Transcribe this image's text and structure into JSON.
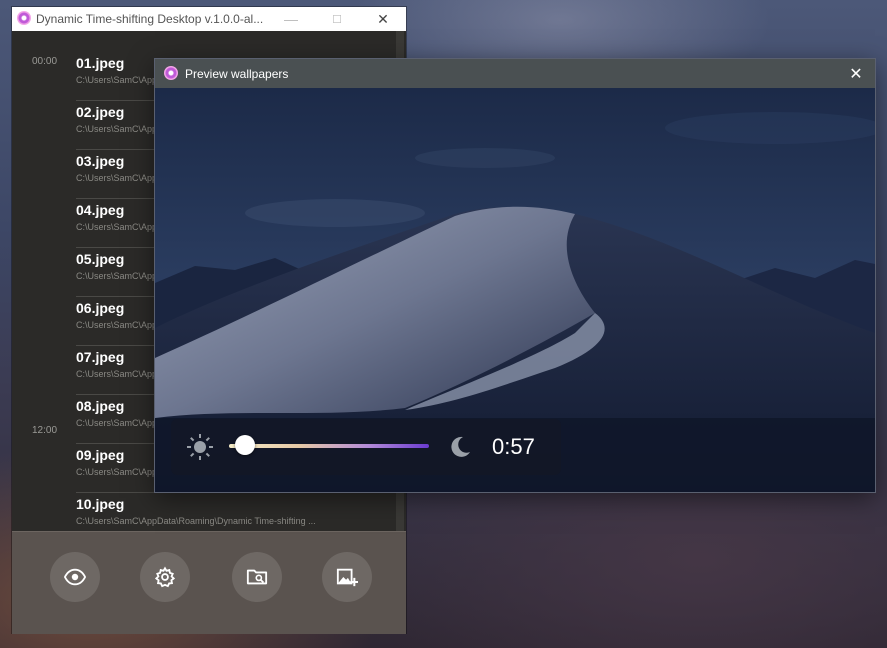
{
  "main_window": {
    "title": "Dynamic Time-shifting Desktop v.1.0.0-al...",
    "controls": {
      "minimize": "—",
      "maximize": "☐",
      "close": "✕"
    }
  },
  "file_list": {
    "time_labels": [
      "00:00",
      "12:00"
    ],
    "items": [
      {
        "name": "01.jpeg",
        "path": "C:\\Users\\SamC\\AppData\\Roaming\\Dynamic Time-shifting ..."
      },
      {
        "name": "02.jpeg",
        "path": "C:\\Users\\SamC\\AppData\\Roaming\\Dynamic Time-shifting ..."
      },
      {
        "name": "03.jpeg",
        "path": "C:\\Users\\SamC\\AppData\\Roaming\\Dynamic Time-shifting ..."
      },
      {
        "name": "04.jpeg",
        "path": "C:\\Users\\SamC\\AppData\\Roaming\\Dynamic Time-shifting ..."
      },
      {
        "name": "05.jpeg",
        "path": "C:\\Users\\SamC\\AppData\\Roaming\\Dynamic Time-shifting ..."
      },
      {
        "name": "06.jpeg",
        "path": "C:\\Users\\SamC\\AppData\\Roaming\\Dynamic Time-shifting ..."
      },
      {
        "name": "07.jpeg",
        "path": "C:\\Users\\SamC\\AppData\\Roaming\\Dynamic Time-shifting ..."
      },
      {
        "name": "08.jpeg",
        "path": "C:\\Users\\SamC\\AppData\\Roaming\\Dynamic Time-shifting ..."
      },
      {
        "name": "09.jpeg",
        "path": "C:\\Users\\SamC\\AppData\\Roaming\\Dynamic Time-shifting ..."
      },
      {
        "name": "10.jpeg",
        "path": "C:\\Users\\SamC\\AppData\\Roaming\\Dynamic Time-shifting ..."
      }
    ]
  },
  "toolbar": {
    "buttons": [
      {
        "icon": "eye-icon"
      },
      {
        "icon": "gear-icon"
      },
      {
        "icon": "folder-search-icon"
      },
      {
        "icon": "add-image-icon"
      }
    ]
  },
  "preview_window": {
    "title": "Preview wallpapers",
    "close": "✕",
    "slider": {
      "left_icon": "sun-icon",
      "right_icon": "moon-icon",
      "value_fraction": 0.08,
      "time": "0:57",
      "gradient_colors": [
        "#f5ecc8",
        "#b28ad8",
        "#6a3bd0"
      ]
    }
  }
}
